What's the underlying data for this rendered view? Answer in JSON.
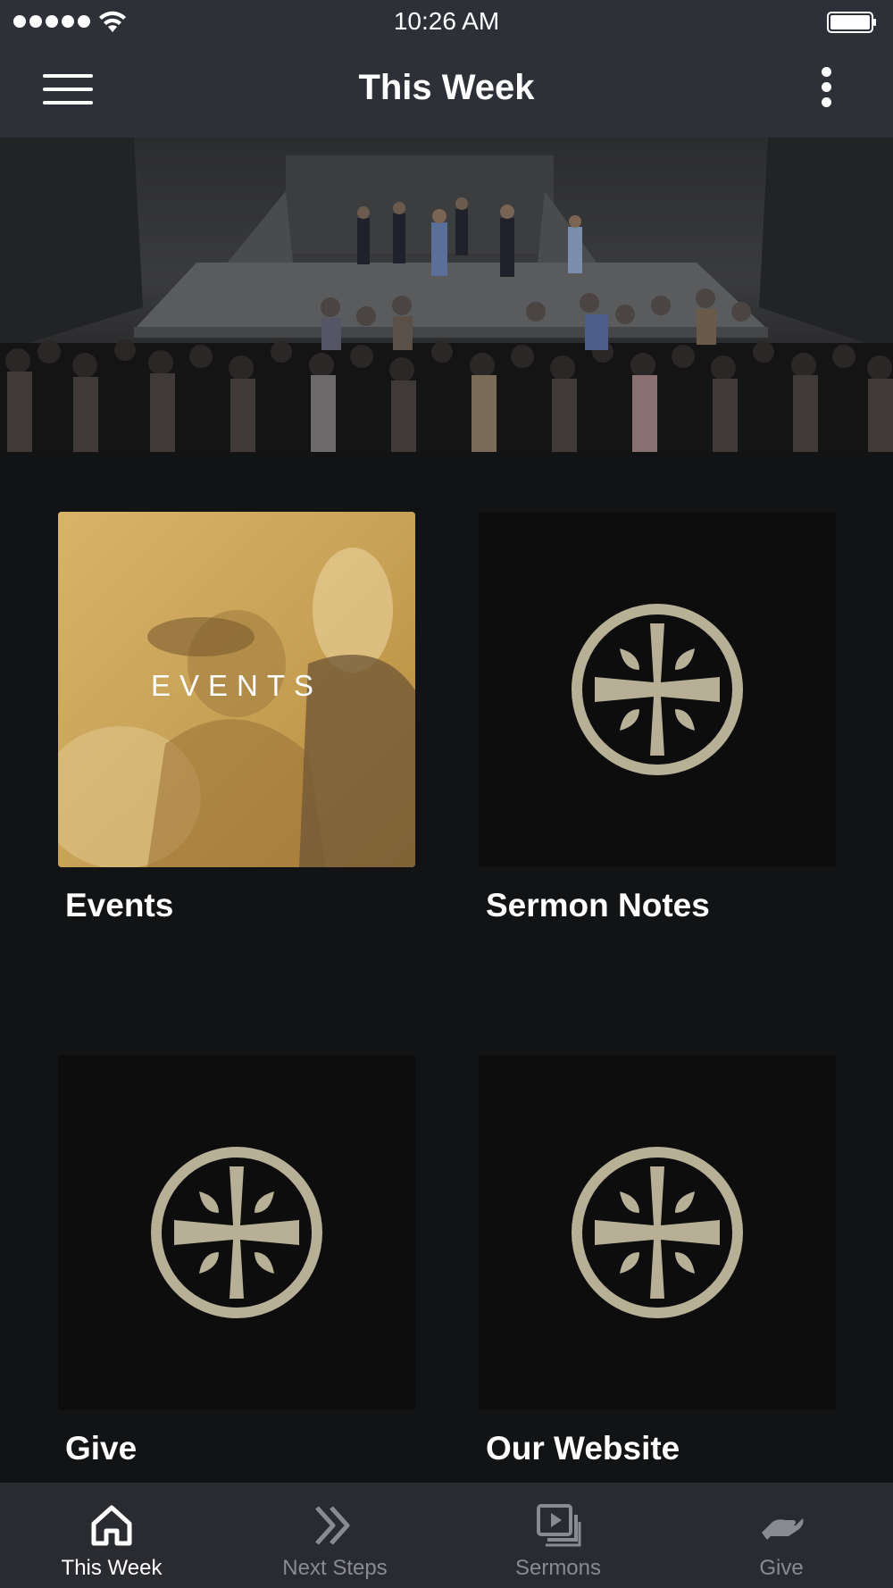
{
  "status_bar": {
    "time": "10:26 AM"
  },
  "nav": {
    "title": "This Week"
  },
  "tiles": [
    {
      "label": "Events",
      "image_text": "EVENTS"
    },
    {
      "label": "Sermon Notes"
    },
    {
      "label": "Give"
    },
    {
      "label": "Our Website"
    }
  ],
  "tab_bar": {
    "tabs": [
      {
        "label": "This Week",
        "icon": "home-icon",
        "active": true
      },
      {
        "label": "Next Steps",
        "icon": "double-chevron-icon",
        "active": false
      },
      {
        "label": "Sermons",
        "icon": "video-stack-icon",
        "active": false
      },
      {
        "label": "Give",
        "icon": "hand-give-icon",
        "active": false
      }
    ]
  },
  "colors": {
    "bar_background": "#2e3038",
    "page_background": "#121315",
    "emblem": "#b8b096",
    "events_overlay": "#c9a24a",
    "tab_inactive": "#8a8b90"
  }
}
